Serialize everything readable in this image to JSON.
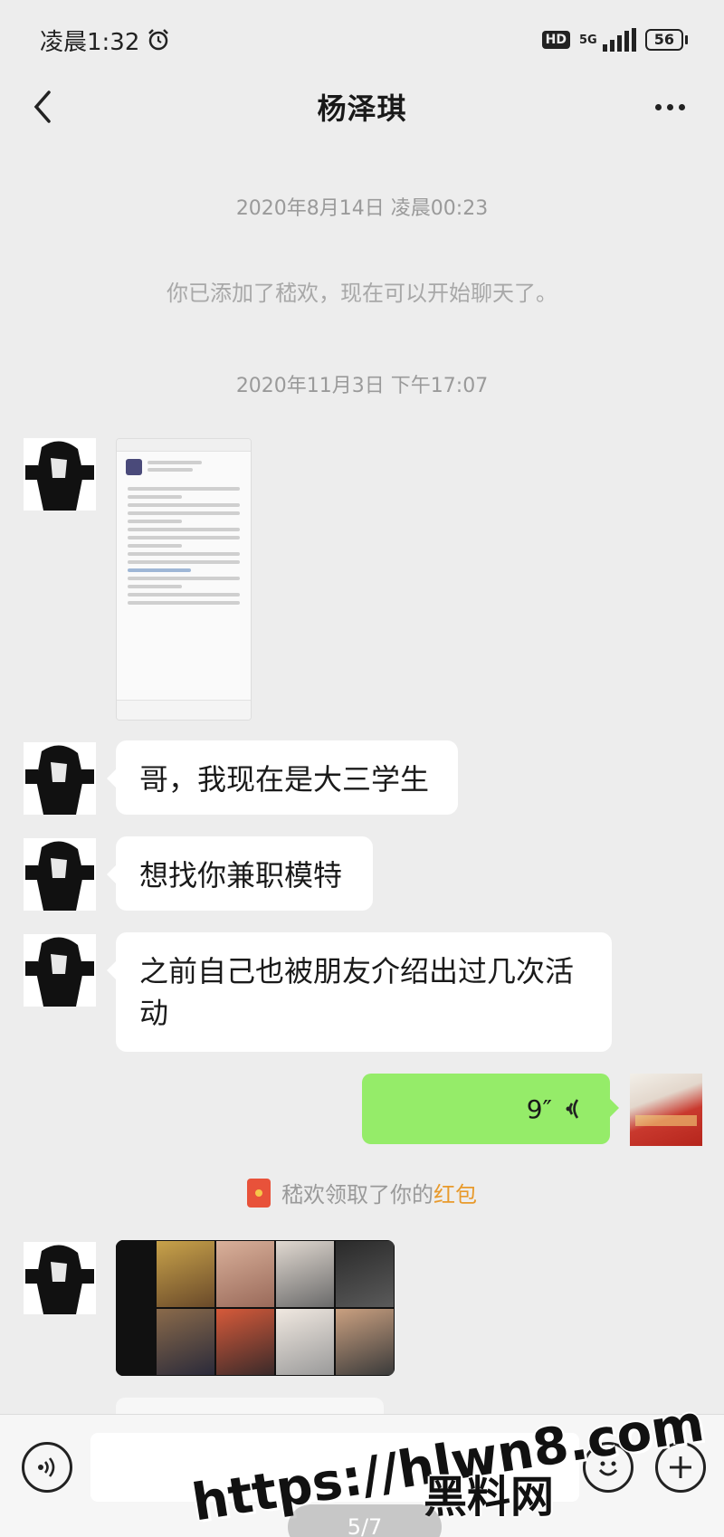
{
  "status_bar": {
    "time": "凌晨1:32",
    "alarm_icon": "alarm-clock-icon",
    "hd": "HD",
    "network": "5G",
    "battery": "56"
  },
  "nav": {
    "title": "杨泽琪",
    "back_icon": "chevron-left-icon",
    "more_icon": "more-dots-icon"
  },
  "messages": {
    "time_1": "2020年8月14日 凌晨00:23",
    "system_added": "你已添加了嵇欢，现在可以开始聊天了。",
    "time_2": "2020年11月3日 下午17:07",
    "msg_1": "哥，我现在是大三学生",
    "msg_2": "想找你兼职模特",
    "msg_3": "之前自己也被朋友介绍出过几次活动",
    "voice_duration": "9″",
    "redpacket_prefix": "嵇欢领取了你的",
    "redpacket_link": "红包"
  },
  "input_bar": {
    "voice_icon": "voice-input-icon",
    "emoji_icon": "emoji-icon",
    "plus_icon": "plus-icon"
  },
  "watermark": {
    "url": "https://hlwn8.com",
    "cn": "黑料网"
  },
  "pager": "5/7"
}
